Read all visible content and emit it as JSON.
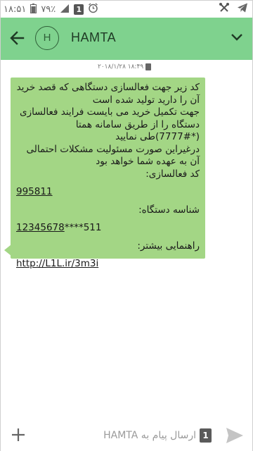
{
  "status_bar": {
    "time": "۱۸:۵۱",
    "battery": "۷۹٪",
    "sim_slot": "1"
  },
  "header": {
    "avatar_letter": "H",
    "title": "HAMTA"
  },
  "message": {
    "timestamp": "۲۰۱۸/۱/۲۸ ۱۸:۴۹",
    "lines": [
      "کد زیر جهت فعالسازی دستگاهی که قصد خرید",
      "آن را دارید تولید شده است",
      "جهت تکمیل خرید می بایست فرایند فعالسازی",
      "دستگاه را از طریق سامانه همتا",
      "(*7777#)طی نمایید",
      "درغیراین صورت مسئولیت مشکلات احتمالی",
      "آن به عهده شما خواهد بود",
      "کد فعالسازی:"
    ],
    "activation_code": "995811",
    "device_id_label": "شناسه دستگاه:",
    "device_id_link": "12345678",
    "device_id_rest": "****511",
    "guide_label": "راهنمایی بیشتر:",
    "guide_link": "http://L1L.ir/3m3i"
  },
  "compose": {
    "placeholder": "ارسال پیام به HAMTA",
    "sim_label": "1"
  },
  "colors": {
    "header": "#7fd28e",
    "bubble": "#a3d685"
  }
}
